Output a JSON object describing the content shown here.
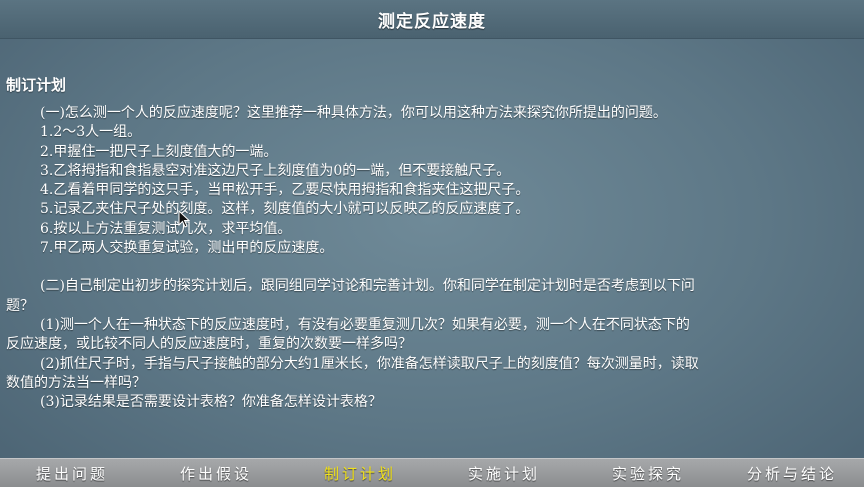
{
  "title": "测定反应速度",
  "section_heading": "制订计划",
  "part1": {
    "intro": "(一)怎么测一个人的反应速度呢？这里推荐一种具体方法，你可以用这种方法来探究你所提出的问题。",
    "steps": [
      "1.2～3人一组。",
      "2.甲握住一把尺子上刻度值大的一端。",
      "3.乙将拇指和食指悬空对准这边尺子上刻度值为0的一端，但不要接触尺子。",
      "4.乙看着甲同学的这只手，当甲松开手，乙要尽快用拇指和食指夹住这把尺子。",
      "5.记录乙夹住尺子处的刻度。这样，刻度值的大小就可以反映乙的反应速度了。",
      "6.按以上方法重复测试几次，求平均值。",
      "7.甲乙两人交换重复试验，测出甲的反应速度。"
    ]
  },
  "part2": {
    "intro_line1": "(二)自己制定出初步的探究计划后，跟同组同学讨论和完善计划。你和同学在制定计划时是否考虑到以下问",
    "intro_line2": "题？",
    "q1_line1": "(1)测一个人在一种状态下的反应速度时，有没有必要重复测几次？如果有必要，测一个人在不同状态下的",
    "q1_line2": "反应速度，或比较不同人的反应速度时，重复的次数要一样多吗？",
    "q2_line1": "(2)抓住尺子时，手指与尺子接触的部分大约1厘米长，你准备怎样读取尺子上的刻度值？每次测量时，读取",
    "q2_line2": "数值的方法当一样吗？",
    "q3": "(3)记录结果是否需要设计表格？你准备怎样设计表格？"
  },
  "nav": {
    "items": [
      "提出问题",
      "作出假设",
      "制订计划",
      "实施计划",
      "实验探究",
      "分析与结论"
    ],
    "active_index": 2
  },
  "colors": {
    "background": "#5d7786",
    "text": "#ffffff",
    "nav_active": "#f2e21a",
    "nav_bar": "#999b9d"
  }
}
